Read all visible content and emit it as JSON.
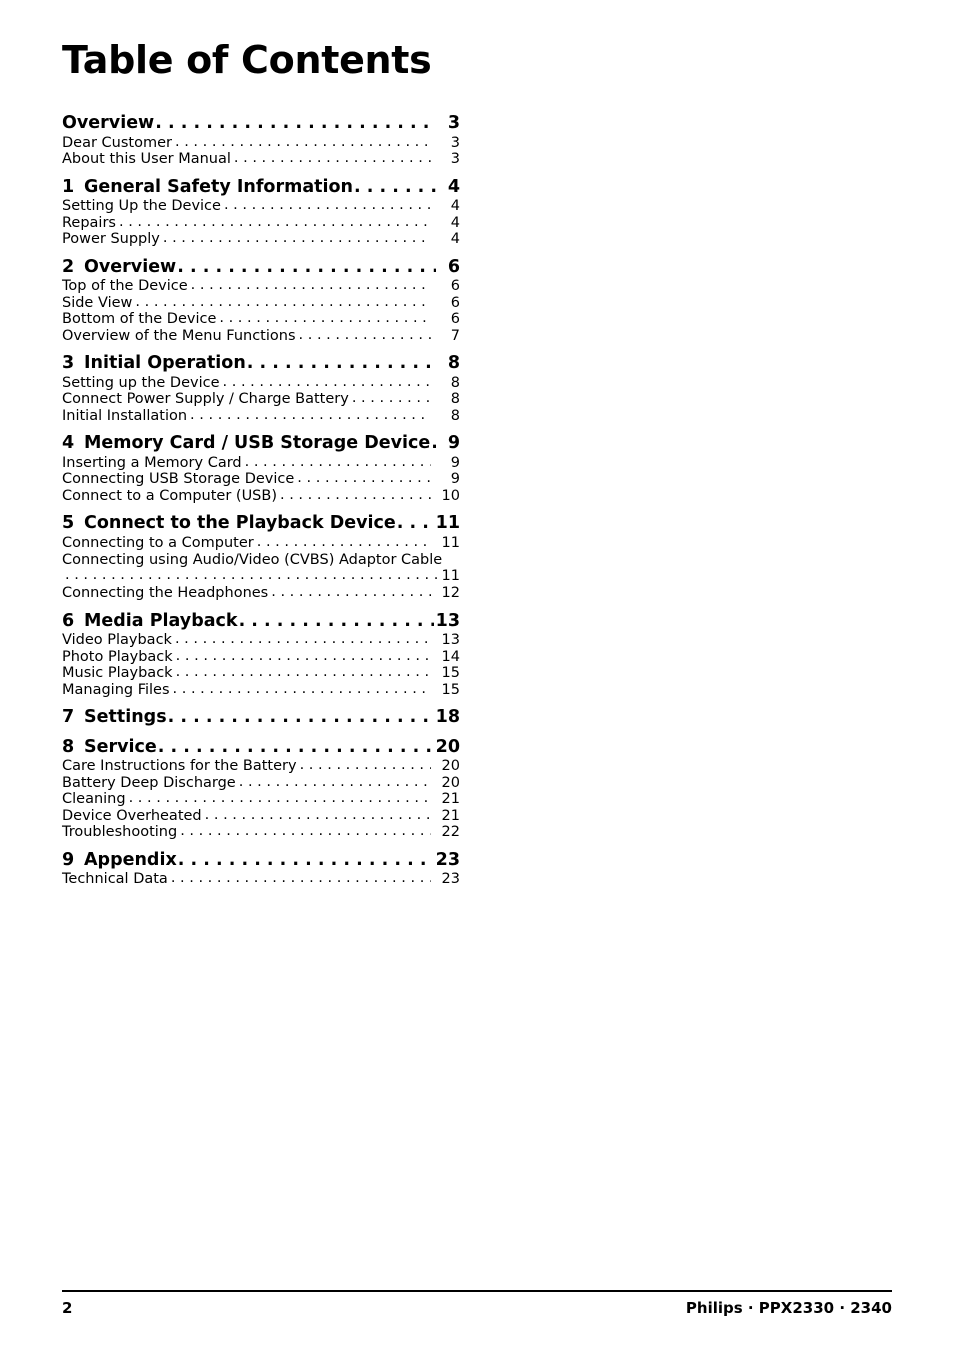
{
  "document": {
    "title": "Table of Contents",
    "page_number": "2",
    "footer_right": "Philips · PPX2330 · 2340"
  },
  "entries": [
    {
      "type": "chapter",
      "num": "",
      "label": "Overview",
      "page": "3"
    },
    {
      "type": "section",
      "label": "Dear Customer",
      "page": "3"
    },
    {
      "type": "section",
      "label": "About this User Manual",
      "page": "3"
    },
    {
      "type": "chapter",
      "num": "1",
      "label": "General Safety Information",
      "page": "4"
    },
    {
      "type": "section",
      "label": "Setting Up the Device",
      "page": "4"
    },
    {
      "type": "section",
      "label": "Repairs",
      "page": "4"
    },
    {
      "type": "section",
      "label": "Power Supply",
      "page": "4"
    },
    {
      "type": "chapter",
      "num": "2",
      "label": "Overview",
      "page": "6"
    },
    {
      "type": "section",
      "label": "Top of the Device",
      "page": "6"
    },
    {
      "type": "section",
      "label": "Side View",
      "page": "6"
    },
    {
      "type": "section",
      "label": "Bottom of the Device",
      "page": "6"
    },
    {
      "type": "section",
      "label": "Overview of the Menu Functions",
      "page": "7"
    },
    {
      "type": "chapter",
      "num": "3",
      "label": "Initial Operation",
      "page": "8"
    },
    {
      "type": "section",
      "label": "Setting up the Device",
      "page": "8"
    },
    {
      "type": "section",
      "label": "Connect Power Supply / Charge Battery",
      "page": "8"
    },
    {
      "type": "section",
      "label": "Initial Installation",
      "page": "8"
    },
    {
      "type": "chapter",
      "num": "4",
      "label": "Memory Card / USB Storage Device",
      "page": "9"
    },
    {
      "type": "section",
      "label": "Inserting a Memory Card",
      "page": "9"
    },
    {
      "type": "section",
      "label": "Connecting USB Storage Device",
      "page": "9"
    },
    {
      "type": "section",
      "label": "Connect to a Computer (USB)",
      "page": "10"
    },
    {
      "type": "chapter",
      "num": "5",
      "label": "Connect to the Playback Device",
      "page": "11"
    },
    {
      "type": "section",
      "label": "Connecting to a Computer",
      "page": "11"
    },
    {
      "type": "section-wrap",
      "label": "Connecting using Audio/Video (CVBS) Adaptor Cable",
      "page": "11"
    },
    {
      "type": "section",
      "label": "Connecting the Headphones",
      "page": "12"
    },
    {
      "type": "chapter",
      "num": "6",
      "label": "Media Playback",
      "page": "13"
    },
    {
      "type": "section",
      "label": "Video Playback",
      "page": "13"
    },
    {
      "type": "section",
      "label": "Photo Playback",
      "page": "14"
    },
    {
      "type": "section",
      "label": "Music Playback",
      "page": "15"
    },
    {
      "type": "section",
      "label": "Managing Files",
      "page": "15"
    },
    {
      "type": "chapter",
      "num": "7",
      "label": "Settings",
      "page": "18"
    },
    {
      "type": "chapter",
      "num": "8",
      "label": "Service",
      "page": "20"
    },
    {
      "type": "section",
      "label": "Care Instructions for the Battery",
      "page": "20"
    },
    {
      "type": "section",
      "label": "Battery Deep Discharge",
      "page": "20"
    },
    {
      "type": "section",
      "label": "Cleaning",
      "page": "21"
    },
    {
      "type": "section",
      "label": "Device Overheated",
      "page": "21"
    },
    {
      "type": "section",
      "label": "Troubleshooting",
      "page": "22"
    },
    {
      "type": "chapter",
      "num": "9",
      "label": "Appendix",
      "page": "23"
    },
    {
      "type": "section",
      "label": "Technical Data",
      "page": "23"
    }
  ],
  "style": {
    "dot_char": ".",
    "text_color": "#000000",
    "background": "#ffffff"
  }
}
